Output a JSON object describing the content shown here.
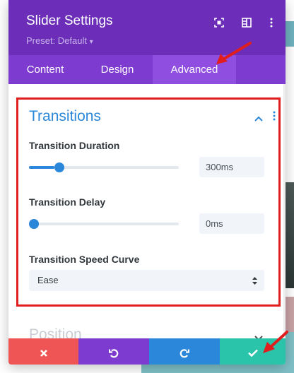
{
  "header": {
    "title": "Slider Settings",
    "preset": "Preset: Default",
    "preset_caret": "▾",
    "icons": [
      "fullscreen-icon",
      "sidebar-icon",
      "more-options-icon"
    ]
  },
  "tabs": [
    {
      "label": "Content",
      "active": false
    },
    {
      "label": "Design",
      "active": false
    },
    {
      "label": "Advanced",
      "active": true
    }
  ],
  "section": {
    "title": "Transitions",
    "collapse_icon": "chevron-up-icon",
    "menu_icon": "vertical-dots-icon"
  },
  "fields": {
    "duration": {
      "label": "Transition Duration",
      "value": "300ms",
      "slider_fraction": 0.17
    },
    "delay": {
      "label": "Transition Delay",
      "value": "0ms",
      "slider_fraction": 0.0
    },
    "speed_curve": {
      "label": "Transition Speed Curve",
      "selected": "Ease"
    }
  },
  "next_section": {
    "title": "Position",
    "icon": "chevron-down-icon"
  },
  "footer": {
    "buttons": [
      {
        "name": "discard-button",
        "icon": "close-icon",
        "color": "#ef5555"
      },
      {
        "name": "undo-button",
        "icon": "undo-icon",
        "color": "#7d3bcf"
      },
      {
        "name": "redo-button",
        "icon": "redo-icon",
        "color": "#2b87da"
      },
      {
        "name": "save-button",
        "icon": "check-icon",
        "color": "#29c4a9"
      }
    ]
  },
  "colors": {
    "header": "#6c2eb9",
    "tabs": "#7d3bcf",
    "accent_blue": "#2b87da",
    "annotation_red": "#e01e1e"
  }
}
